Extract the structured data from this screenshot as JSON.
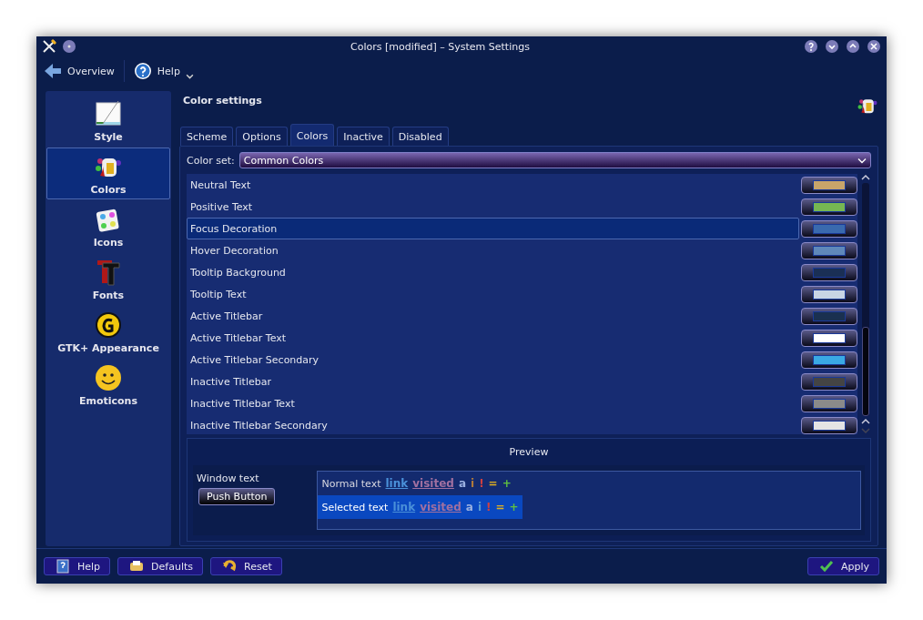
{
  "window": {
    "title": "Colors [modified] – System Settings"
  },
  "toolbar": [
    {
      "label": "Overview",
      "kind": "back"
    },
    {
      "label": "Help",
      "kind": "help"
    }
  ],
  "sidebar": {
    "items": [
      {
        "label": "Style",
        "kind": "style",
        "selected": false
      },
      {
        "label": "Colors",
        "kind": "colors",
        "selected": true
      },
      {
        "label": "Icons",
        "kind": "icons",
        "selected": false
      },
      {
        "label": "Fonts",
        "kind": "fonts",
        "selected": false
      },
      {
        "label": "GTK+ Appearance",
        "kind": "gtk",
        "selected": false
      },
      {
        "label": "Emoticons",
        "kind": "emoticons",
        "selected": false
      }
    ]
  },
  "heading": "Color settings",
  "tabs": [
    {
      "label": "Scheme",
      "selected": false
    },
    {
      "label": "Options",
      "selected": false
    },
    {
      "label": "Colors",
      "selected": true
    },
    {
      "label": "Inactive",
      "selected": false
    },
    {
      "label": "Disabled",
      "selected": false
    }
  ],
  "color_set": {
    "label": "Color set:",
    "value": "Common Colors"
  },
  "color_rows": [
    {
      "name": "Neutral Text",
      "color": "#c8a56a",
      "selected": false
    },
    {
      "name": "Positive Text",
      "color": "#76b752",
      "selected": false
    },
    {
      "name": "Focus Decoration",
      "color": "#3a6aae",
      "selected": true
    },
    {
      "name": "Hover Decoration",
      "color": "#5f88ba",
      "selected": false
    },
    {
      "name": "Tooltip Background",
      "color": "#1a2f55",
      "selected": false
    },
    {
      "name": "Tooltip Text",
      "color": "#c9d5e4",
      "selected": false
    },
    {
      "name": "Active Titlebar",
      "color": "#1a3050",
      "selected": false
    },
    {
      "name": "Active Titlebar Text",
      "color": "#ffffff",
      "selected": false
    },
    {
      "name": "Active Titlebar Secondary",
      "color": "#3aa9e4",
      "selected": false
    },
    {
      "name": "Inactive Titlebar",
      "color": "#444444",
      "selected": false
    },
    {
      "name": "Inactive Titlebar Text",
      "color": "#8a8a8a",
      "selected": false
    },
    {
      "name": "Inactive Titlebar Secondary",
      "color": "#e4e4e4",
      "selected": false
    }
  ],
  "preview": {
    "title": "Preview",
    "window_text": "Window text",
    "button": "Push Button",
    "lines": [
      {
        "selected": false,
        "tokens": [
          {
            "text": "Normal text",
            "kind": "plain",
            "color": "#d8d8e0"
          },
          {
            "text": "link",
            "kind": "link",
            "color": "#4a90d9"
          },
          {
            "text": "visited",
            "kind": "link",
            "color": "#a070a0"
          },
          {
            "text": "a",
            "kind": "plain",
            "color": "#9ab0e0"
          },
          {
            "text": "i",
            "kind": "plain",
            "color": "#b07a3a"
          },
          {
            "text": "!",
            "kind": "plain",
            "color": "#d04040"
          },
          {
            "text": "=",
            "kind": "plain",
            "color": "#e0b020"
          },
          {
            "text": "+",
            "kind": "plain",
            "color": "#60c040"
          }
        ]
      },
      {
        "selected": true,
        "tokens": [
          {
            "text": "Selected text",
            "kind": "plain",
            "color": "#ffffff"
          },
          {
            "text": "link",
            "kind": "link",
            "color": "#4a90d9"
          },
          {
            "text": "visited",
            "kind": "link",
            "color": "#a070a0"
          },
          {
            "text": "a",
            "kind": "plain",
            "color": "#9ab0e0"
          },
          {
            "text": "i",
            "kind": "plain",
            "color": "#5a9ad0"
          },
          {
            "text": "!",
            "kind": "plain",
            "color": "#d04040"
          },
          {
            "text": "=",
            "kind": "plain",
            "color": "#e0b020"
          },
          {
            "text": "+",
            "kind": "plain",
            "color": "#60c040"
          }
        ]
      }
    ]
  },
  "buttons": [
    {
      "label": "Help",
      "kind": "help"
    },
    {
      "label": "Defaults",
      "kind": "defaults"
    },
    {
      "label": "Reset",
      "kind": "reset"
    },
    {
      "label": "Apply",
      "kind": "apply"
    }
  ]
}
